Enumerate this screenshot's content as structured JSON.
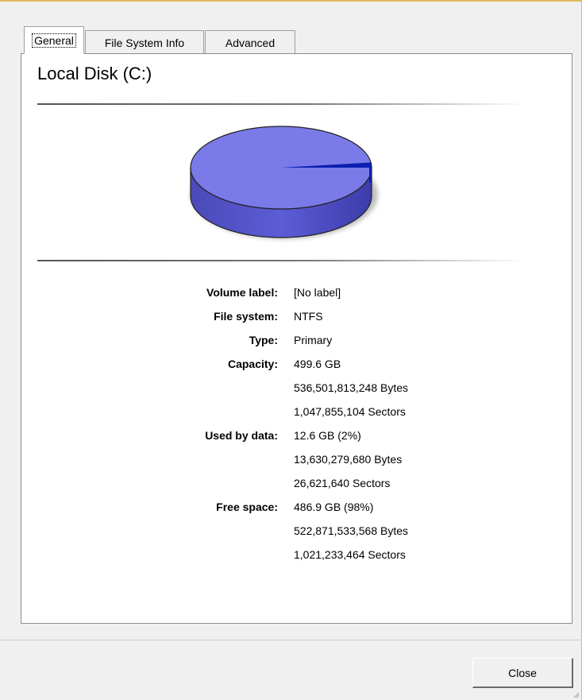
{
  "tabs": [
    {
      "label": "General"
    },
    {
      "label": "File System Info"
    },
    {
      "label": "Advanced"
    }
  ],
  "title": "Local Disk (C:)",
  "usage": {
    "used_fraction": 0.02,
    "free_fraction": 0.98
  },
  "colors": {
    "free": "#7a7ae8",
    "used": "#0a1fb0",
    "accent_border": "#e5b85c"
  },
  "info": [
    {
      "label": "Volume label:",
      "values": [
        "[No label]"
      ]
    },
    {
      "label": "File system:",
      "values": [
        "NTFS"
      ]
    },
    {
      "label": "Type:",
      "values": [
        "Primary"
      ]
    },
    {
      "label": "Capacity:",
      "values": [
        "499.6 GB",
        "536,501,813,248 Bytes",
        "1,047,855,104 Sectors"
      ]
    },
    {
      "label": "Used by data:",
      "values": [
        "12.6 GB (2%)",
        "13,630,279,680 Bytes",
        "26,621,640 Sectors"
      ]
    },
    {
      "label": "Free space:",
      "values": [
        "486.9 GB (98%)",
        "522,871,533,568 Bytes",
        "1,021,233,464 Sectors"
      ]
    }
  ],
  "close_label": "Close"
}
